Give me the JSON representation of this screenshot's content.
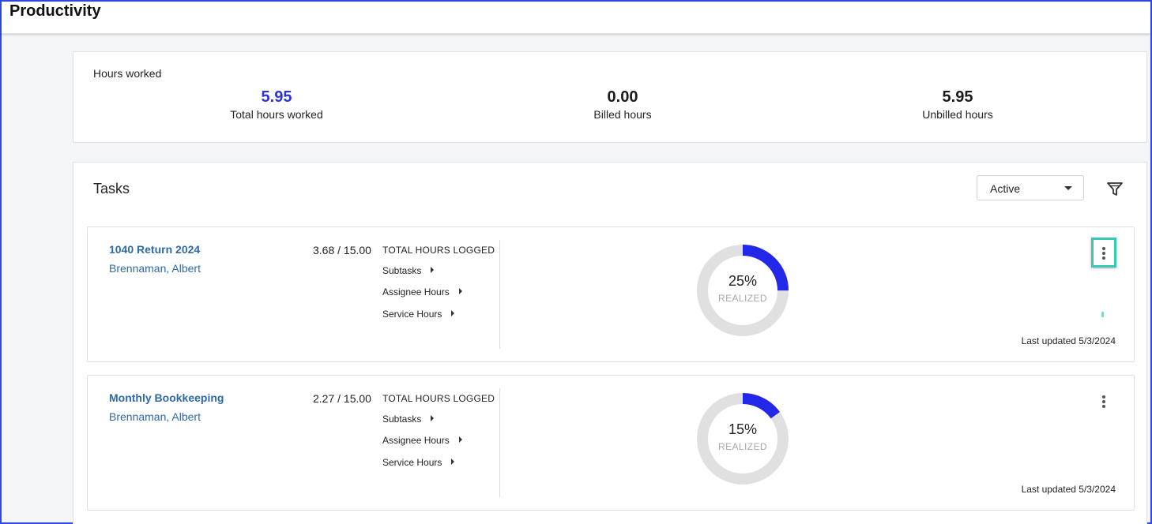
{
  "header": {
    "title": "Productivity"
  },
  "hours_worked": {
    "title": "Hours worked",
    "metrics": [
      {
        "value": "5.95",
        "label": "Total hours worked"
      },
      {
        "value": "0.00",
        "label": "Billed hours"
      },
      {
        "value": "5.95",
        "label": "Unbilled hours"
      }
    ]
  },
  "tasks": {
    "title": "Tasks",
    "status_filter": "Active",
    "items": [
      {
        "name": "1040 Return 2024",
        "assignee": "Brennaman, Albert",
        "hours": "3.68 / 15.00",
        "hours_label": "TOTAL HOURS LOGGED",
        "links": [
          "Subtasks",
          "Assignee Hours",
          "Service Hours"
        ],
        "realized_pct": 25,
        "realized_text": "25%",
        "realized_label": "REALIZED",
        "updated": "Last updated 5/3/2024"
      },
      {
        "name": "Monthly Bookkeeping",
        "assignee": "Brennaman, Albert",
        "hours": "2.27 / 15.00",
        "hours_label": "TOTAL HOURS LOGGED",
        "links": [
          "Subtasks",
          "Assignee Hours",
          "Service Hours"
        ],
        "realized_pct": 15,
        "realized_text": "15%",
        "realized_label": "REALIZED",
        "updated": "Last updated 5/3/2024"
      }
    ]
  },
  "colors": {
    "accent": "#2b35d6",
    "donut_fill": "#2328e8",
    "donut_track": "#e0e0e0",
    "link": "#2e6aa8",
    "focus": "#38c9b0"
  },
  "icons": {
    "filter": "filter-icon",
    "menu": "more-vertical-icon",
    "dropdown": "caret-down-icon",
    "expand": "caret-right-icon"
  }
}
